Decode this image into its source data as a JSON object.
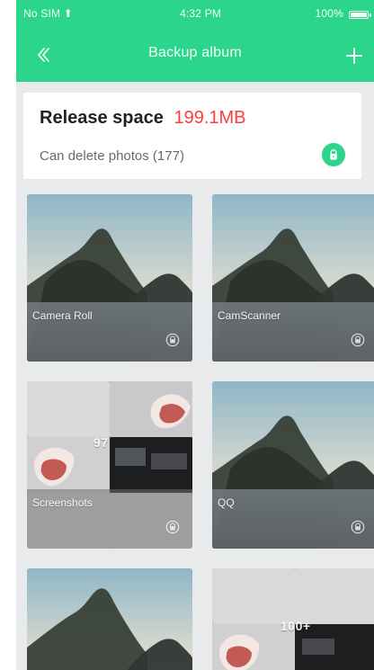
{
  "status_bar": {
    "left": "No SIM ⬆",
    "time": "4:32 PM",
    "right": "100%",
    "battery_level": 0.92
  },
  "nav": {
    "title": "Backup album"
  },
  "release": {
    "title": "Release space",
    "amount": "199.1MB",
    "subtitle": "Can delete photos (177)"
  },
  "albums": [
    {
      "name": "Camera Roll"
    },
    {
      "name": "CamScanner"
    },
    {
      "name": "Screenshots",
      "count_badge": "97"
    },
    {
      "name": "QQ"
    },
    {
      "name": ""
    },
    {
      "name": "",
      "count_badge": "100+"
    }
  ],
  "colors": {
    "accent": "#2bd68c",
    "danger": "#ff3b3b"
  },
  "icons": {
    "back": "double-chevron-left-icon",
    "add": "plus-icon",
    "release_action": "lock-icon",
    "album_status": "lock-icon"
  }
}
